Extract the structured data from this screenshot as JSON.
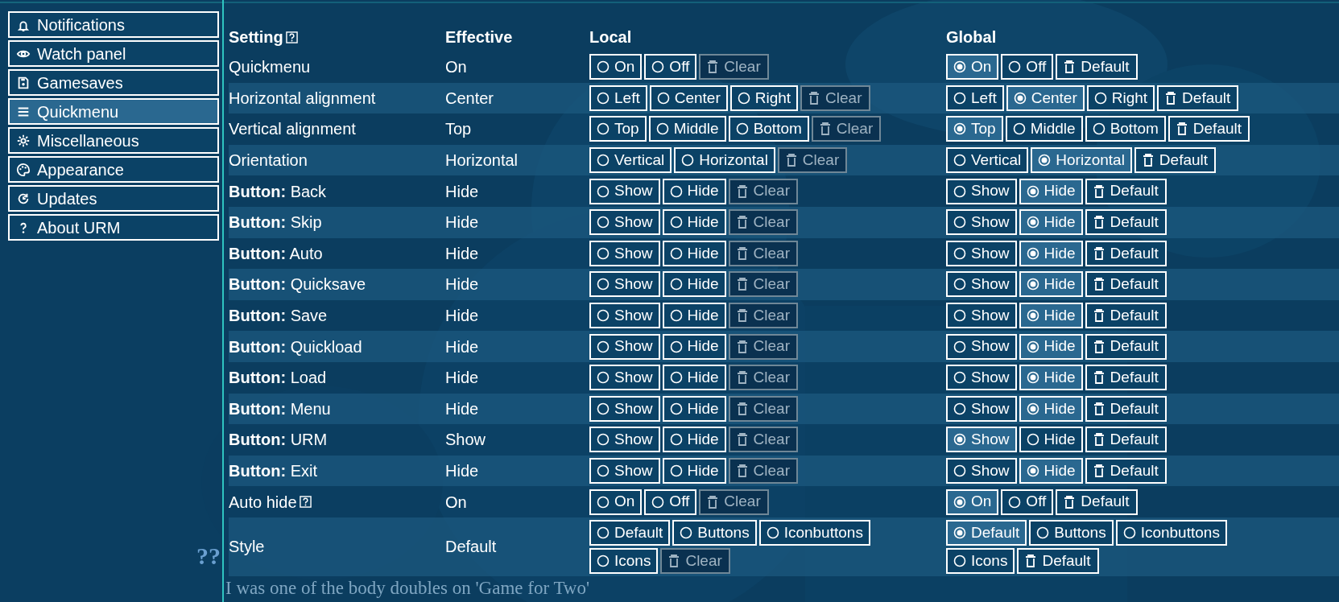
{
  "sidebar": {
    "items": [
      {
        "label": "Notifications",
        "kind": "bell",
        "selected": false
      },
      {
        "label": "Watch panel",
        "kind": "eye",
        "selected": false
      },
      {
        "label": "Gamesaves",
        "kind": "save",
        "selected": false
      },
      {
        "label": "Quickmenu",
        "kind": "menu",
        "selected": true
      },
      {
        "label": "Miscellaneous",
        "kind": "gear",
        "selected": false
      },
      {
        "label": "Appearance",
        "kind": "palette",
        "selected": false
      },
      {
        "label": "Updates",
        "kind": "update",
        "selected": false
      },
      {
        "label": "About URM",
        "kind": "question",
        "selected": false
      }
    ]
  },
  "table": {
    "columns": [
      {
        "label": "Setting",
        "help": true
      },
      {
        "label": "Effective",
        "help": false
      },
      {
        "label": "Local",
        "help": false
      },
      {
        "label": "Global",
        "help": false
      }
    ],
    "rows": [
      {
        "setting": "Quickmenu",
        "help": false,
        "effective": "On",
        "local": {
          "options": [
            {
              "label": "On",
              "selected": false
            },
            {
              "label": "Off",
              "selected": false
            }
          ],
          "reset": {
            "label": "Clear",
            "disabled": true
          }
        },
        "global": {
          "options": [
            {
              "label": "On",
              "selected": true
            },
            {
              "label": "Off",
              "selected": false
            }
          ],
          "reset": {
            "label": "Default",
            "disabled": false
          }
        }
      },
      {
        "setting": "Horizontal alignment",
        "help": false,
        "effective": "Center",
        "local": {
          "options": [
            {
              "label": "Left",
              "selected": false
            },
            {
              "label": "Center",
              "selected": false
            },
            {
              "label": "Right",
              "selected": false
            }
          ],
          "reset": {
            "label": "Clear",
            "disabled": true
          }
        },
        "global": {
          "options": [
            {
              "label": "Left",
              "selected": false
            },
            {
              "label": "Center",
              "selected": true
            },
            {
              "label": "Right",
              "selected": false
            }
          ],
          "reset": {
            "label": "Default",
            "disabled": false
          }
        }
      },
      {
        "setting": "Vertical alignment",
        "help": false,
        "effective": "Top",
        "local": {
          "options": [
            {
              "label": "Top",
              "selected": false
            },
            {
              "label": "Middle",
              "selected": false
            },
            {
              "label": "Bottom",
              "selected": false
            }
          ],
          "reset": {
            "label": "Clear",
            "disabled": true
          }
        },
        "global": {
          "options": [
            {
              "label": "Top",
              "selected": true
            },
            {
              "label": "Middle",
              "selected": false
            },
            {
              "label": "Bottom",
              "selected": false
            }
          ],
          "reset": {
            "label": "Default",
            "disabled": false
          }
        }
      },
      {
        "setting": "Orientation",
        "help": false,
        "effective": "Horizontal",
        "local": {
          "options": [
            {
              "label": "Vertical",
              "selected": false
            },
            {
              "label": "Horizontal",
              "selected": false
            }
          ],
          "reset": {
            "label": "Clear",
            "disabled": true
          }
        },
        "global": {
          "options": [
            {
              "label": "Vertical",
              "selected": false
            },
            {
              "label": "Horizontal",
              "selected": true
            }
          ],
          "reset": {
            "label": "Default",
            "disabled": false
          }
        }
      },
      {
        "setting": "**Button:** Back",
        "help": false,
        "effective": "Hide",
        "local": {
          "options": [
            {
              "label": "Show",
              "selected": false
            },
            {
              "label": "Hide",
              "selected": false
            }
          ],
          "reset": {
            "label": "Clear",
            "disabled": true
          }
        },
        "global": {
          "options": [
            {
              "label": "Show",
              "selected": false
            },
            {
              "label": "Hide",
              "selected": true
            }
          ],
          "reset": {
            "label": "Default",
            "disabled": false
          }
        }
      },
      {
        "setting": "**Button:** Skip",
        "help": false,
        "effective": "Hide",
        "local": {
          "options": [
            {
              "label": "Show",
              "selected": false
            },
            {
              "label": "Hide",
              "selected": false
            }
          ],
          "reset": {
            "label": "Clear",
            "disabled": true
          }
        },
        "global": {
          "options": [
            {
              "label": "Show",
              "selected": false
            },
            {
              "label": "Hide",
              "selected": true
            }
          ],
          "reset": {
            "label": "Default",
            "disabled": false
          }
        }
      },
      {
        "setting": "**Button:** Auto",
        "help": false,
        "effective": "Hide",
        "local": {
          "options": [
            {
              "label": "Show",
              "selected": false
            },
            {
              "label": "Hide",
              "selected": false
            }
          ],
          "reset": {
            "label": "Clear",
            "disabled": true
          }
        },
        "global": {
          "options": [
            {
              "label": "Show",
              "selected": false
            },
            {
              "label": "Hide",
              "selected": true
            }
          ],
          "reset": {
            "label": "Default",
            "disabled": false
          }
        }
      },
      {
        "setting": "**Button:** Quicksave",
        "help": false,
        "effective": "Hide",
        "local": {
          "options": [
            {
              "label": "Show",
              "selected": false
            },
            {
              "label": "Hide",
              "selected": false
            }
          ],
          "reset": {
            "label": "Clear",
            "disabled": true
          }
        },
        "global": {
          "options": [
            {
              "label": "Show",
              "selected": false
            },
            {
              "label": "Hide",
              "selected": true
            }
          ],
          "reset": {
            "label": "Default",
            "disabled": false
          }
        }
      },
      {
        "setting": "**Button:** Save",
        "help": false,
        "effective": "Hide",
        "local": {
          "options": [
            {
              "label": "Show",
              "selected": false
            },
            {
              "label": "Hide",
              "selected": false
            }
          ],
          "reset": {
            "label": "Clear",
            "disabled": true
          }
        },
        "global": {
          "options": [
            {
              "label": "Show",
              "selected": false
            },
            {
              "label": "Hide",
              "selected": true
            }
          ],
          "reset": {
            "label": "Default",
            "disabled": false
          }
        }
      },
      {
        "setting": "**Button:** Quickload",
        "help": false,
        "effective": "Hide",
        "local": {
          "options": [
            {
              "label": "Show",
              "selected": false
            },
            {
              "label": "Hide",
              "selected": false
            }
          ],
          "reset": {
            "label": "Clear",
            "disabled": true
          }
        },
        "global": {
          "options": [
            {
              "label": "Show",
              "selected": false
            },
            {
              "label": "Hide",
              "selected": true
            }
          ],
          "reset": {
            "label": "Default",
            "disabled": false
          }
        }
      },
      {
        "setting": "**Button:** Load",
        "help": false,
        "effective": "Hide",
        "local": {
          "options": [
            {
              "label": "Show",
              "selected": false
            },
            {
              "label": "Hide",
              "selected": false
            }
          ],
          "reset": {
            "label": "Clear",
            "disabled": true
          }
        },
        "global": {
          "options": [
            {
              "label": "Show",
              "selected": false
            },
            {
              "label": "Hide",
              "selected": true
            }
          ],
          "reset": {
            "label": "Default",
            "disabled": false
          }
        }
      },
      {
        "setting": "**Button:** Menu",
        "help": false,
        "effective": "Hide",
        "local": {
          "options": [
            {
              "label": "Show",
              "selected": false
            },
            {
              "label": "Hide",
              "selected": false
            }
          ],
          "reset": {
            "label": "Clear",
            "disabled": true
          }
        },
        "global": {
          "options": [
            {
              "label": "Show",
              "selected": false
            },
            {
              "label": "Hide",
              "selected": true
            }
          ],
          "reset": {
            "label": "Default",
            "disabled": false
          }
        }
      },
      {
        "setting": "**Button:** URM",
        "help": false,
        "effective": "Show",
        "local": {
          "options": [
            {
              "label": "Show",
              "selected": false
            },
            {
              "label": "Hide",
              "selected": false
            }
          ],
          "reset": {
            "label": "Clear",
            "disabled": true
          }
        },
        "global": {
          "options": [
            {
              "label": "Show",
              "selected": true
            },
            {
              "label": "Hide",
              "selected": false
            }
          ],
          "reset": {
            "label": "Default",
            "disabled": false
          }
        }
      },
      {
        "setting": "**Button:** Exit",
        "help": false,
        "effective": "Hide",
        "local": {
          "options": [
            {
              "label": "Show",
              "selected": false
            },
            {
              "label": "Hide",
              "selected": false
            }
          ],
          "reset": {
            "label": "Clear",
            "disabled": true
          }
        },
        "global": {
          "options": [
            {
              "label": "Show",
              "selected": false
            },
            {
              "label": "Hide",
              "selected": true
            }
          ],
          "reset": {
            "label": "Default",
            "disabled": false
          }
        }
      },
      {
        "setting": "Auto hide",
        "help": true,
        "effective": "On",
        "local": {
          "options": [
            {
              "label": "On",
              "selected": false
            },
            {
              "label": "Off",
              "selected": false
            }
          ],
          "reset": {
            "label": "Clear",
            "disabled": true
          }
        },
        "global": {
          "options": [
            {
              "label": "On",
              "selected": true
            },
            {
              "label": "Off",
              "selected": false
            }
          ],
          "reset": {
            "label": "Default",
            "disabled": false
          }
        }
      },
      {
        "setting": "Style",
        "help": false,
        "effective": "Default",
        "local": {
          "options": [
            {
              "label": "Default",
              "selected": false
            },
            {
              "label": "Buttons",
              "selected": false
            },
            {
              "label": "Iconbuttons",
              "selected": false
            },
            {
              "label": "Icons",
              "selected": false
            }
          ],
          "reset": {
            "label": "Clear",
            "disabled": true
          }
        },
        "global": {
          "options": [
            {
              "label": "Default",
              "selected": true
            },
            {
              "label": "Buttons",
              "selected": false
            },
            {
              "label": "Iconbuttons",
              "selected": false
            },
            {
              "label": "Icons",
              "selected": false
            }
          ],
          "reset": {
            "label": "Default",
            "disabled": false
          }
        }
      }
    ]
  },
  "dialogue": {
    "speaker": "??",
    "text": "I was one of the body doubles on 'Game for Two'"
  }
}
